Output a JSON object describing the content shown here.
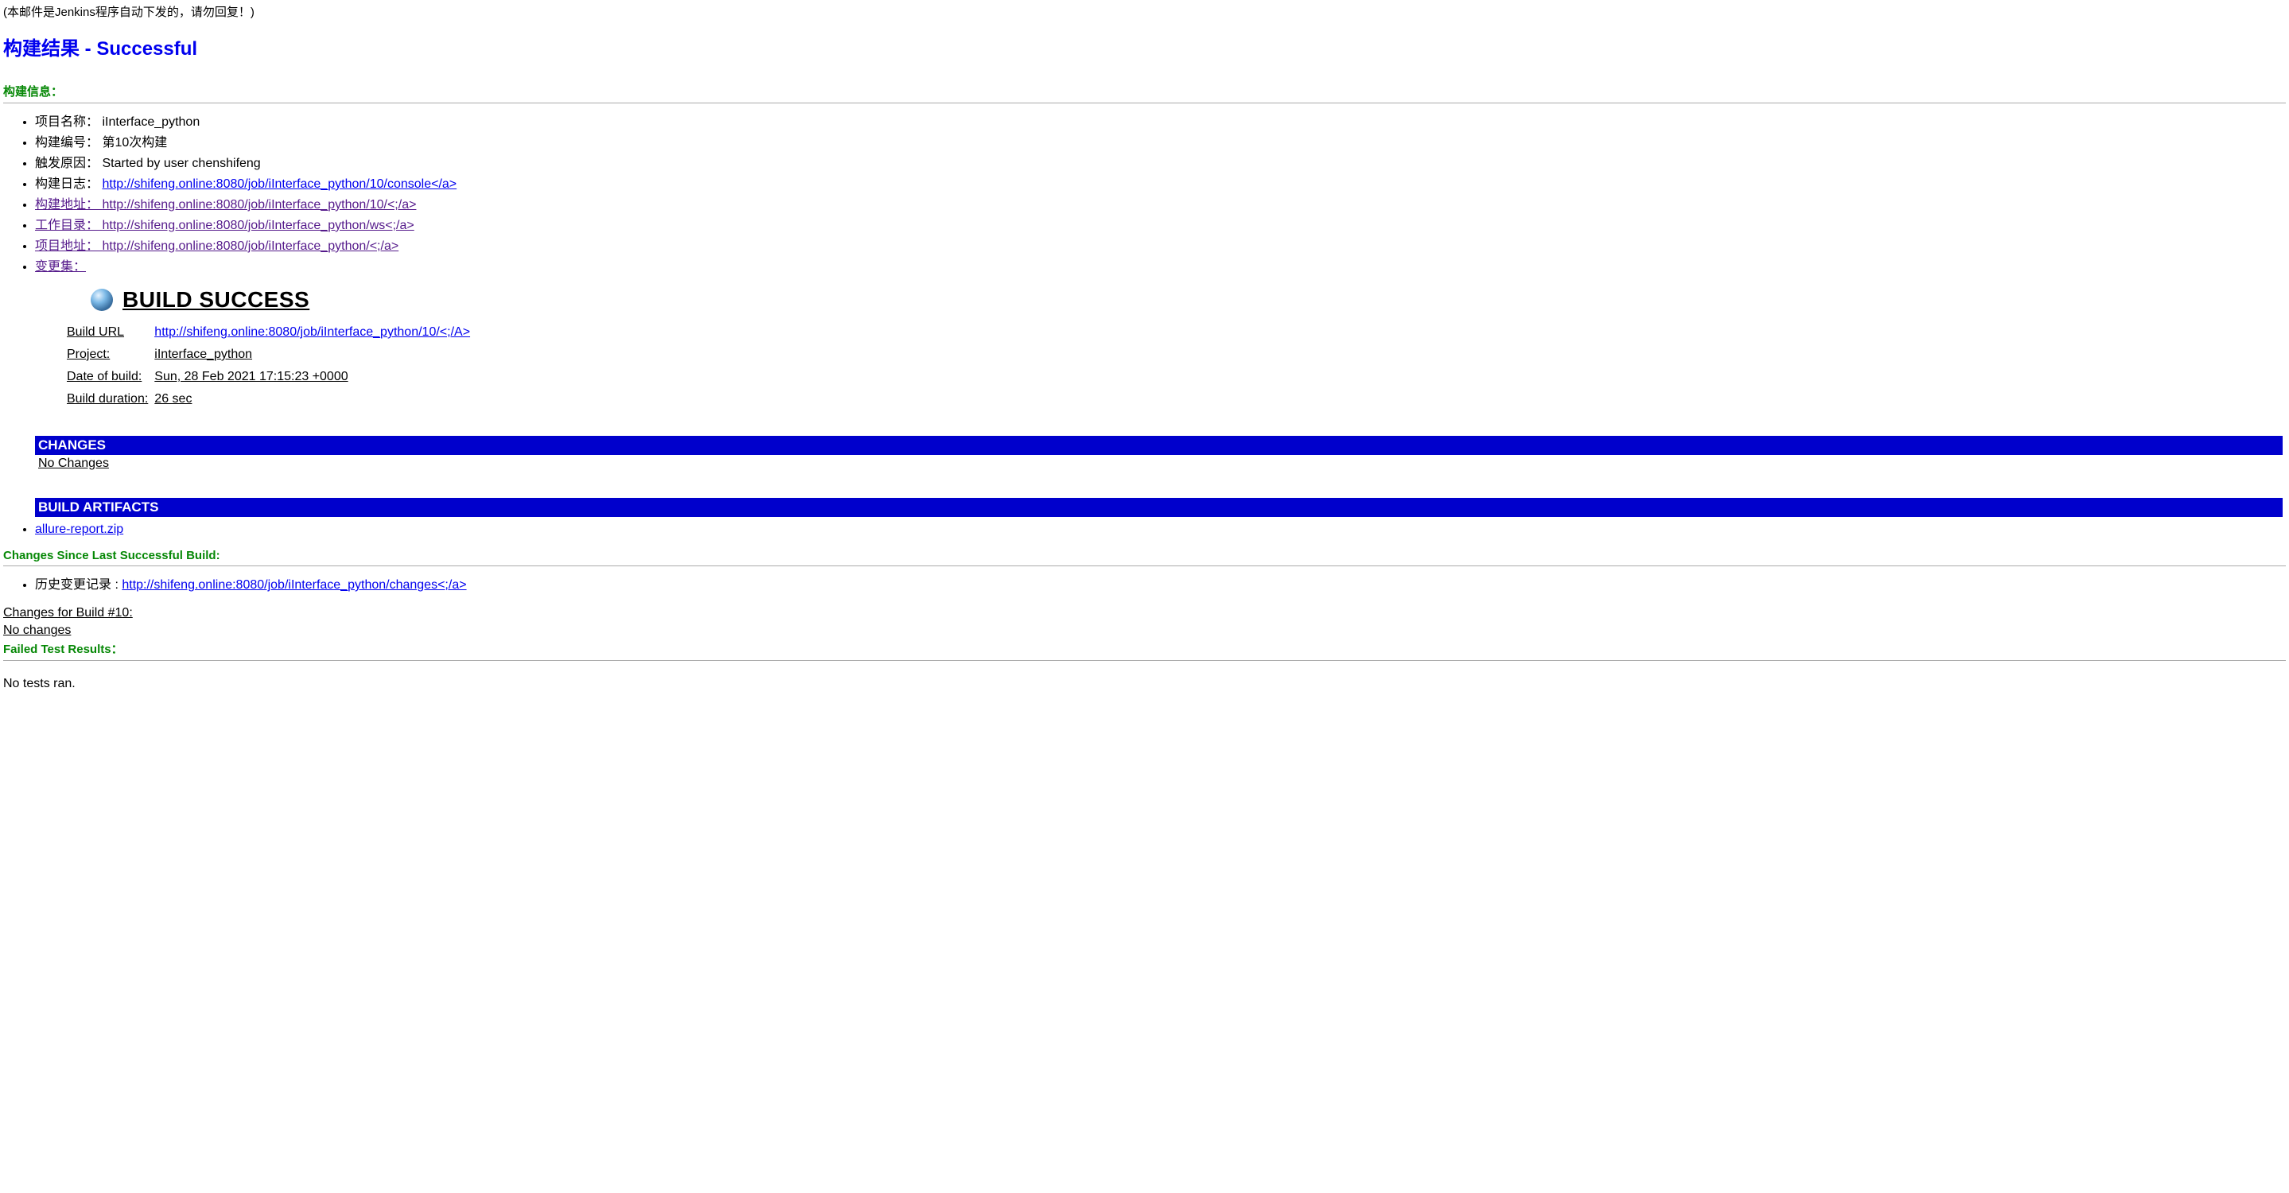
{
  "notice": "(本邮件是Jenkins程序自动下发的，请勿回复！)",
  "result_title": "构建结果 - Successful",
  "build_info_heading": "构建信息：",
  "items": {
    "project_name_label": "项目名称：",
    "project_name_value": "iInterface_python",
    "build_number_label": "构建编号：",
    "build_number_value": "第10次构建",
    "trigger_label": "触发原因：",
    "trigger_value": "Started by user chenshifeng",
    "build_log_label": "构建日志：",
    "build_log_link": "http://shifeng.online:8080/job/iInterface_python/10/console</a>",
    "build_url_label": "构建地址：",
    "build_url_link": "http://shifeng.online:8080/job/iInterface_python/10/<;/a>",
    "workspace_label": "工作目录：",
    "workspace_link": "http://shifeng.online:8080/job/iInterface_python/ws<;/a>",
    "project_url_label": "项目地址：",
    "project_url_link": "http://shifeng.online:8080/job/iInterface_python/<;/a>",
    "changeset_label": "变更集："
  },
  "build_success_title": "BUILD SUCCESS",
  "table": {
    "build_url_label": "Build URL",
    "build_url_value": "http://shifeng.online:8080/job/iInterface_python/10/<;/A>",
    "project_label": "Project:",
    "project_value": "iInterface_python",
    "date_label": "Date of build:",
    "date_value": "Sun, 28 Feb 2021 17:15:23 +0000",
    "duration_label": "Build duration:",
    "duration_value": "26 sec"
  },
  "changes_bar": "CHANGES",
  "no_changes": "No Changes",
  "artifacts_bar": "BUILD ARTIFACTS",
  "artifact_link": "allure-report.zip",
  "changes_since_heading": "Changes Since Last Successful Build:",
  "history_label": "历史变更记录 : ",
  "history_link": "http://shifeng.online:8080/job/iInterface_python/changes<;/a>",
  "changes_for_build": "Changes for Build #10:",
  "no_changes_line": "No changes",
  "failed_results_heading": "Failed Test Results：",
  "no_tests_ran": "No tests ran."
}
